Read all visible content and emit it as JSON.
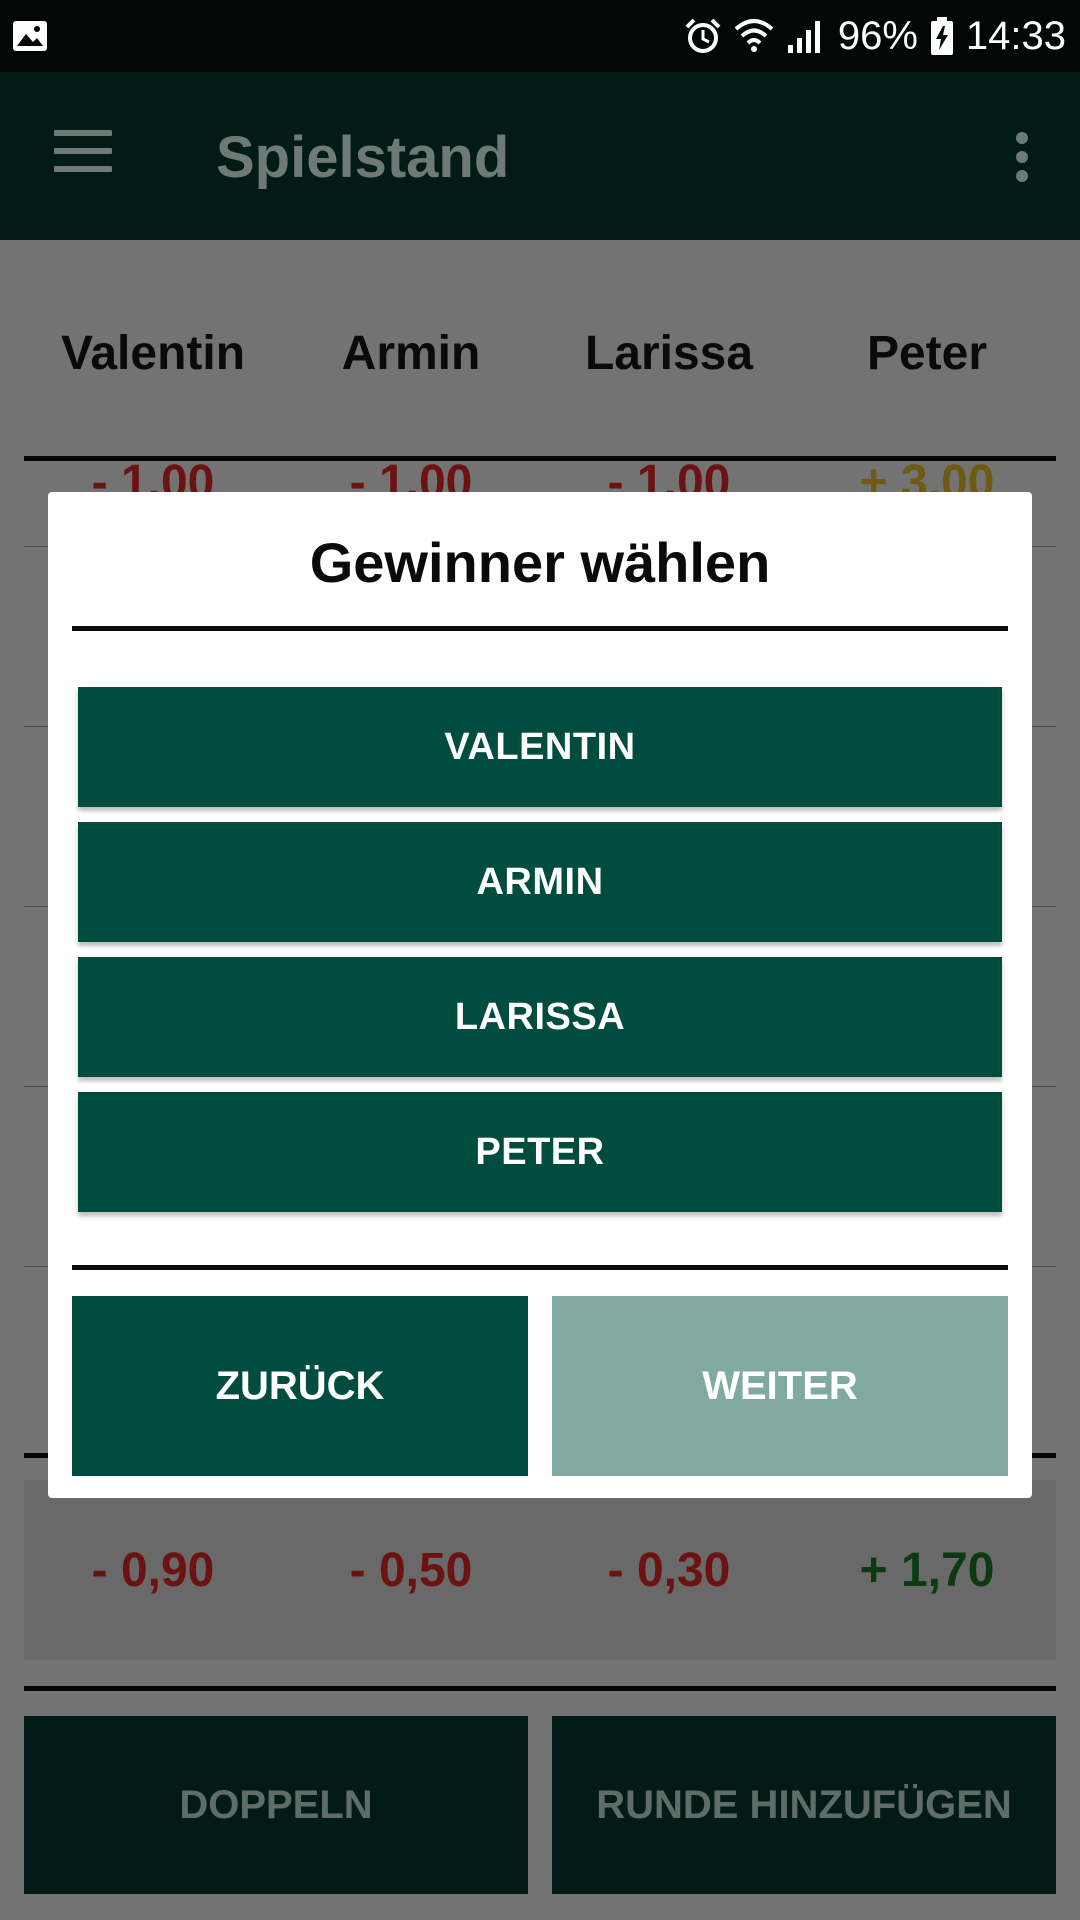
{
  "status_bar": {
    "battery": "96%",
    "time": "14:33",
    "icons": [
      "image-icon",
      "alarm-icon",
      "wifi-icon",
      "signal-icon",
      "battery-charging-icon"
    ]
  },
  "app_bar": {
    "title": "Spielstand",
    "menu_icon": "hamburger-menu-icon",
    "more_icon": "more-vert-icon"
  },
  "score_table": {
    "players": [
      "Valentin",
      "Armin",
      "Larissa",
      "Peter"
    ],
    "row1": [
      "- 1,00",
      "- 1,00",
      "- 1,00",
      "+ 3,00"
    ],
    "totals": [
      "- 0,90",
      "- 0,50",
      "- 0,30",
      "+ 1,70"
    ]
  },
  "bottom_buttons": {
    "double_label": "DOPPELN",
    "add_round_label": "RUNDE HINZUFÜGEN"
  },
  "dialog": {
    "title": "Gewinner wählen",
    "choices": [
      "VALENTIN",
      "ARMIN",
      "LARISSA",
      "PETER"
    ],
    "back_label": "ZURÜCK",
    "next_label": "WEITER"
  },
  "colors": {
    "primary": "#004d40",
    "primary_disabled": "#80aaa0",
    "negative": "#b71c1c",
    "positive": "#1b5e20"
  }
}
